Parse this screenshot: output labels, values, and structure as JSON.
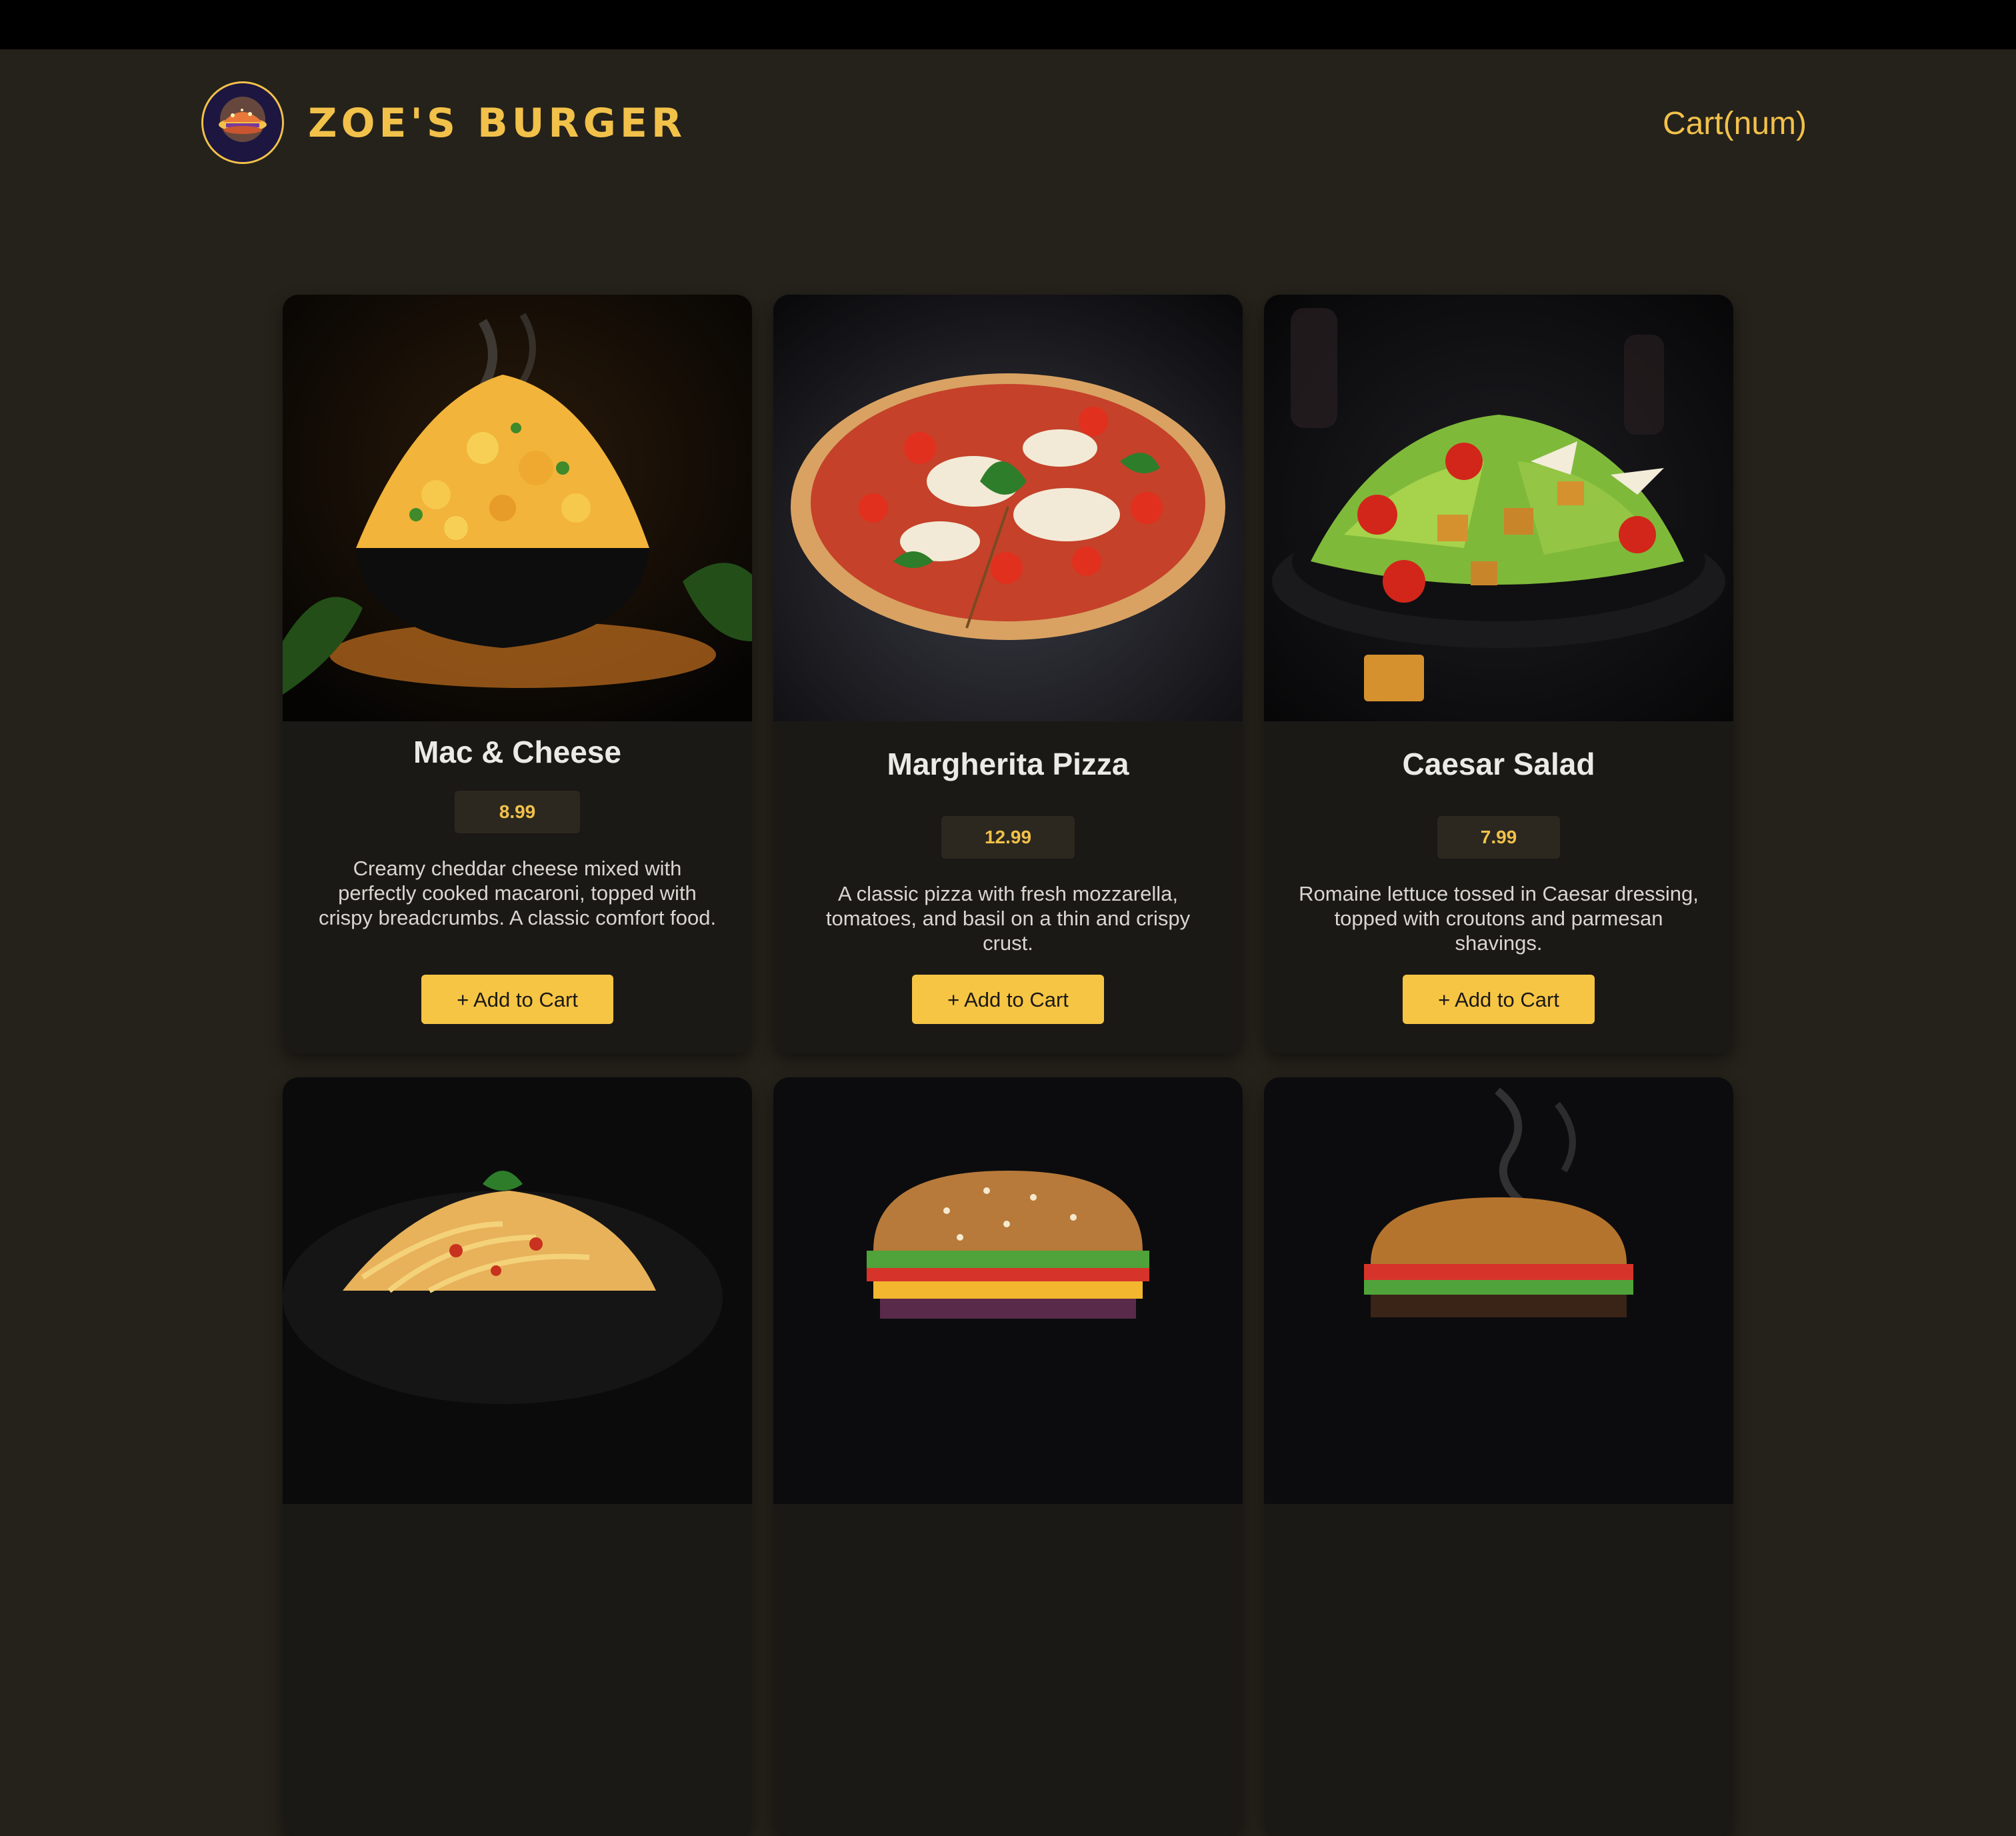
{
  "header": {
    "brand": "ZOE'S BURGER",
    "cart_label": "Cart(num)",
    "logo_icon": "burger-planet-logo"
  },
  "colors": {
    "accent": "#f2c14a",
    "background": "#25221b",
    "card": "#1b1916",
    "button": "#f6c544"
  },
  "menu": {
    "items": [
      {
        "name": "Mac & Cheese",
        "price": "8.99",
        "description": "Creamy cheddar cheese mixed with perfectly cooked macaroni, topped with crispy breadcrumbs. A classic comfort food.",
        "button": "+ Add to Cart",
        "image": "mac-and-cheese-photo"
      },
      {
        "name": "Margherita Pizza",
        "price": "12.99",
        "description": "A classic pizza with fresh mozzarella, tomatoes, and basil on a thin and crispy crust.",
        "button": "+ Add to Cart",
        "image": "margherita-pizza-photo"
      },
      {
        "name": "Caesar Salad",
        "price": "7.99",
        "description": "Romaine lettuce tossed in Caesar dressing, topped with croutons and parmesan shavings.",
        "button": "+ Add to Cart",
        "image": "caesar-salad-photo"
      },
      {
        "image": "spaghetti-photo"
      },
      {
        "image": "sesame-burger-photo"
      },
      {
        "image": "smoking-burger-photo"
      }
    ]
  }
}
